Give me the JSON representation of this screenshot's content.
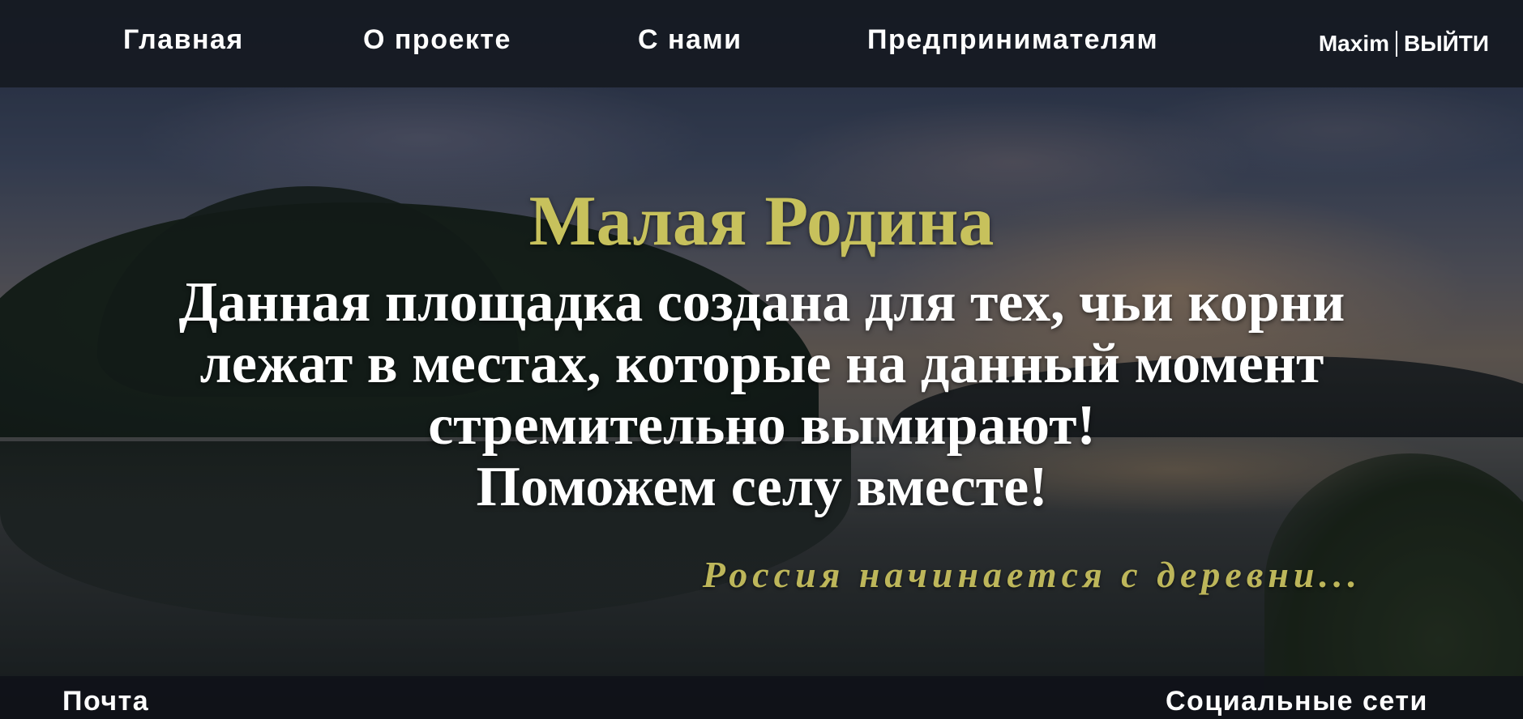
{
  "nav": {
    "items": [
      {
        "label": "Главная"
      },
      {
        "label": "О проекте"
      },
      {
        "label": "С нами"
      },
      {
        "label": "Предпринимателям"
      }
    ],
    "user": {
      "name": "Maxim",
      "logout_label": "ВЫЙТИ"
    }
  },
  "hero": {
    "title": "Малая Родина",
    "lines": [
      "Данная площадка создана для тех, чьи корни",
      "лежат в местах, которые на данный момент",
      "стремительно вымирают!",
      "Поможем селу вместе!"
    ],
    "slogan": "Россия начинается с деревни..."
  },
  "footer": {
    "left_label": "Почта",
    "right_label": "Социальные сети"
  },
  "colors": {
    "accent": "#c7c15c",
    "nav_bg": "#161a22",
    "text": "#ffffff"
  }
}
